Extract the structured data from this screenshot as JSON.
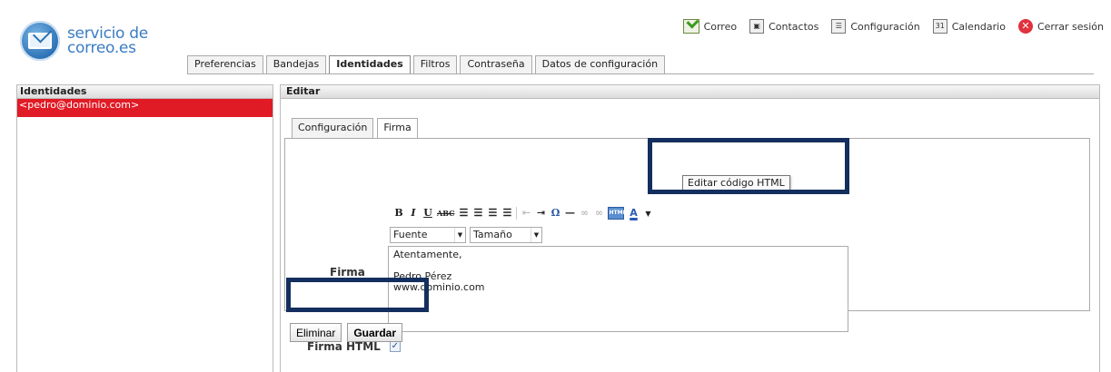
{
  "logo": {
    "line1": "servicio de",
    "line2": "correo.es"
  },
  "topnav": [
    {
      "label": "Correo",
      "icon": "mail-inbox-icon"
    },
    {
      "label": "Contactos",
      "icon": "address-book-icon"
    },
    {
      "label": "Configuración",
      "icon": "settings-panel-icon"
    },
    {
      "label": "Calendario",
      "icon": "calendar-icon",
      "day": "31"
    },
    {
      "label": "Cerrar sesión",
      "icon": "logout-icon"
    }
  ],
  "tabs": [
    "Preferencias",
    "Bandejas",
    "Identidades",
    "Filtros",
    "Contraseña",
    "Datos de configuración"
  ],
  "active_tab": "Identidades",
  "left_panel": {
    "title": "Identidades",
    "items": [
      "<pedro@dominio.com>"
    ]
  },
  "right_panel": {
    "title": "Editar",
    "subtabs": [
      "Configuración",
      "Firma"
    ],
    "active_subtab": "Firma",
    "firma_label": "Firma",
    "editor": {
      "font_select": "Fuente",
      "size_select": "Tamaño",
      "tooltip": "Editar código HTML",
      "html_button_label": "HTML",
      "content": [
        "Atentamente,",
        "",
        "Pedro Pérez",
        "www.dominio.com"
      ]
    },
    "firma_html_label": "Firma HTML",
    "firma_html_checked": true,
    "buttons": {
      "delete": "Eliminar",
      "save": "Guardar"
    }
  },
  "colors": {
    "selected_row": "#e11b26",
    "highlight_box": "#142e5e",
    "logo_text": "#3a7cc3"
  }
}
